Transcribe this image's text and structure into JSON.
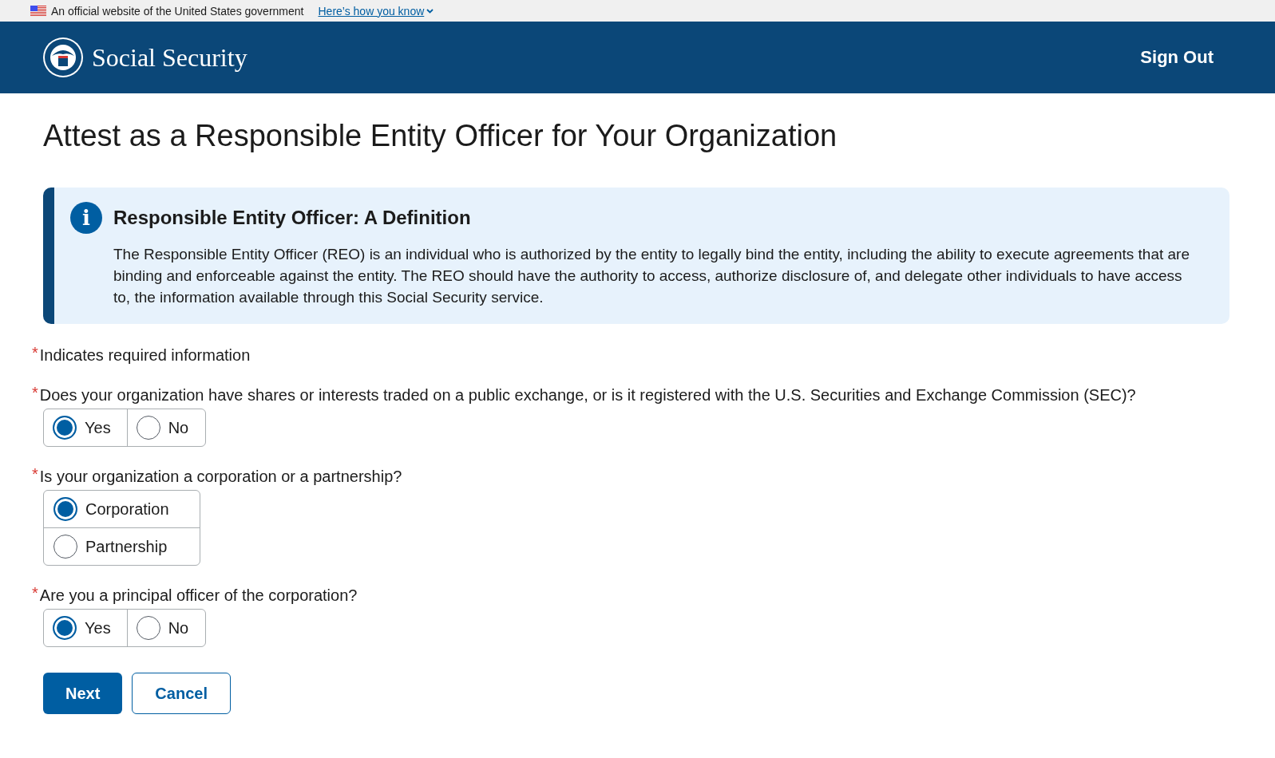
{
  "gov_banner": {
    "text": "An official website of the United States government",
    "link": "Here’s how you know"
  },
  "header": {
    "site_title": "Social Security",
    "sign_out": "Sign Out"
  },
  "page_title": "Attest as a Responsible Entity Officer for Your Organization",
  "info_alert": {
    "icon": "i",
    "heading": "Responsible Entity Officer: A Definition",
    "body": "The Responsible Entity Officer (REO) is an individual who is authorized by the entity to legally bind the entity, including the ability to execute agreements that are binding and enforceable against the entity. The REO should have the authority to access, authorize disclosure of, and delegate other individuals to have access to, the information available through this Social Security service."
  },
  "required_legend": {
    "mark": "*",
    "text": "Indicates required information"
  },
  "questions": [
    {
      "kind": "inline",
      "mark": "*",
      "label": "Does your organization have shares or interests traded on a public exchange, or is it registered with the U.S. Securities and Exchange Commission (SEC)?",
      "options": [
        {
          "label": "Yes",
          "selected": true
        },
        {
          "label": "No",
          "selected": false
        }
      ]
    },
    {
      "kind": "stacked",
      "mark": "*",
      "label": "Is your organization a corporation or a partnership?",
      "options": [
        {
          "label": "Corporation",
          "selected": true
        },
        {
          "label": "Partnership",
          "selected": false
        }
      ]
    },
    {
      "kind": "inline",
      "mark": "*",
      "label": "Are you a principal officer of the corporation?",
      "options": [
        {
          "label": "Yes",
          "selected": true
        },
        {
          "label": "No",
          "selected": false
        }
      ]
    }
  ],
  "buttons": [
    {
      "kind": "primary",
      "label": "Next"
    },
    {
      "kind": "outline",
      "label": "Cancel"
    }
  ]
}
